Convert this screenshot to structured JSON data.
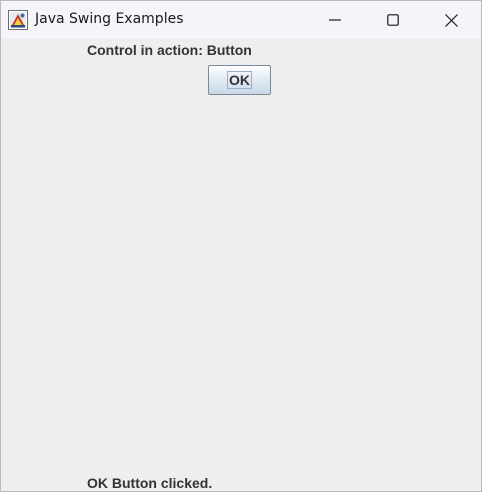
{
  "window": {
    "title": "Java Swing Examples",
    "icon": "java-app-icon",
    "controls": {
      "minimize_icon": "minimize-icon",
      "maximize_icon": "maximize-icon",
      "close_icon": "close-icon"
    }
  },
  "main": {
    "header_label": "Control in action: Button",
    "ok_button_label": "OK",
    "status_label": "OK Button clicked."
  },
  "colors": {
    "window_background": "#eeeeee",
    "titlebar_background": "#f3f5fa",
    "label_text": "#333333",
    "button_border": "#7a8a99"
  }
}
